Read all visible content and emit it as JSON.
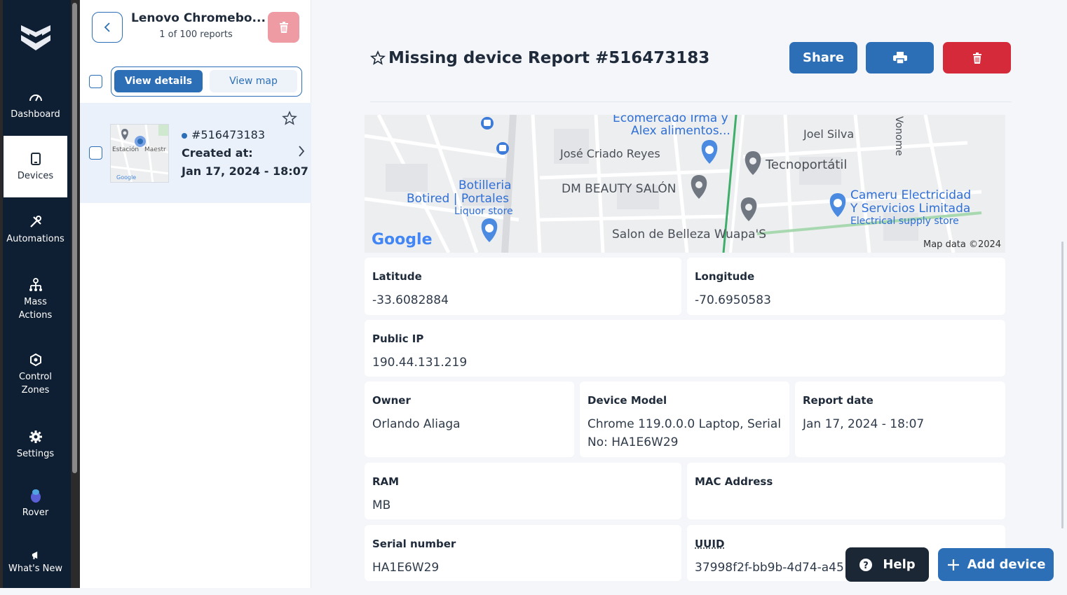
{
  "sidebar": {
    "items": [
      {
        "label": "Dashboard",
        "icon": "gauge-icon"
      },
      {
        "label": "Devices",
        "icon": "device-icon"
      },
      {
        "label": "Automations",
        "icon": "tools-icon"
      },
      {
        "label": "Mass Actions",
        "icon": "hierarchy-icon"
      },
      {
        "label": "Control Zones",
        "icon": "zone-icon"
      },
      {
        "label": "Settings",
        "icon": "gear-icon"
      },
      {
        "label": "Rover",
        "icon": "rover-icon"
      },
      {
        "label": "What's New",
        "icon": "megaphone-icon"
      }
    ]
  },
  "list": {
    "title": "Lenovo Chromebo...",
    "subtitle": "1 of 100 reports",
    "view_details": "View details",
    "view_map": "View map",
    "row": {
      "id": "#516473183",
      "created_label": "Created at:",
      "created_date": "Jan 17, 2024 - 18:07",
      "thumb_labels": {
        "left": "Estación",
        "right": "Maestr",
        "brand": "Google"
      }
    }
  },
  "report": {
    "title": "Missing device Report #516473183",
    "share": "Share"
  },
  "map": {
    "labels": {
      "ecom1": "Ecomercado Irma y",
      "ecom2": "Alex alimentos...",
      "jose": "José Criado Reyes",
      "joel": "Joel Silva",
      "vonome": "Vonome",
      "tecno": "Tecnoportátil",
      "dm": "DM BEAUTY SALÓN",
      "salon": "Salon de Belleza Wuapa'S",
      "bot1": "Botilleria",
      "bot2": "Botired | Portales",
      "bot3": "Liquor store",
      "cam1": "Cameru Electricidad",
      "cam2": "Y Servicios Limitada",
      "cam3": "Electrical supply store",
      "google": "Google",
      "mapdata": "Map data ©2024"
    }
  },
  "fields": {
    "latitude": {
      "label": "Latitude",
      "value": "-33.6082884"
    },
    "longitude": {
      "label": "Longitude",
      "value": "-70.6950583"
    },
    "public_ip": {
      "label": "Public IP",
      "value": "190.44.131.219"
    },
    "owner": {
      "label": "Owner",
      "value": "Orlando Aliaga"
    },
    "device_model": {
      "label": "Device Model",
      "value": "Chrome 119.0.0.0 Laptop, Serial No: HA1E6W29"
    },
    "report_date": {
      "label": "Report date",
      "value": "Jan 17, 2024 - 18:07"
    },
    "ram": {
      "label": "RAM",
      "value": "MB"
    },
    "mac": {
      "label": "MAC Address",
      "value": ""
    },
    "serial": {
      "label": "Serial number",
      "value": "HA1E6W29"
    },
    "uuid": {
      "label": "UUID",
      "value": "37998f2f-bb9b-4d74-a45"
    }
  },
  "floating": {
    "help": "Help",
    "add_device": "Add device"
  },
  "colors": {
    "primary": "#2c6fb7",
    "danger": "#d42a3a",
    "sidebar": "#0f1f33",
    "dark_button": "#1c2735"
  }
}
